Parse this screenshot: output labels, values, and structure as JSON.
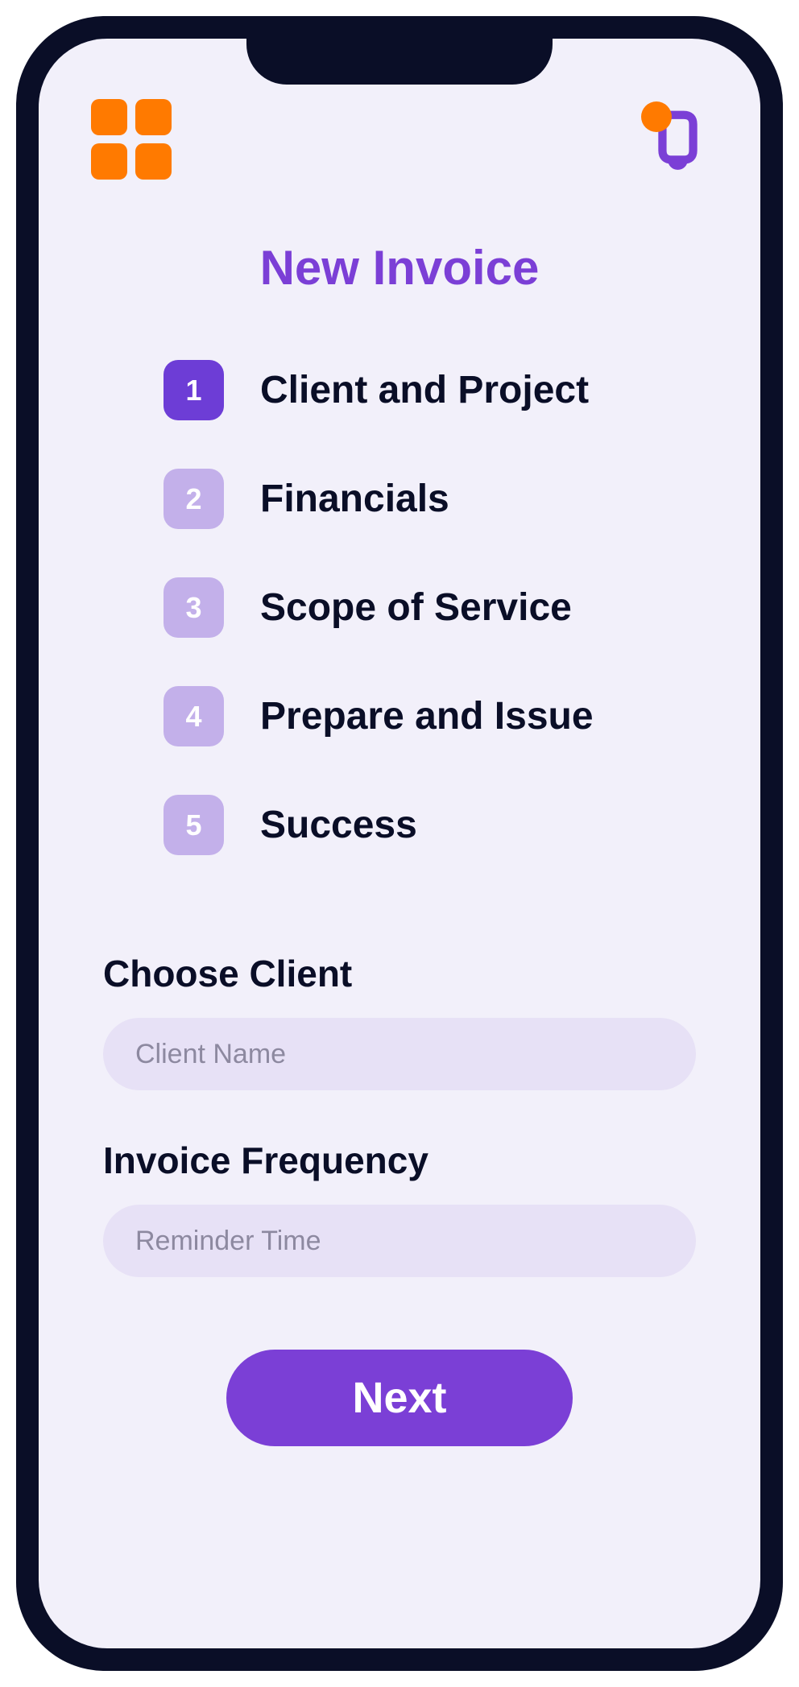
{
  "header": {
    "menu_icon": "apps-grid-icon",
    "notification_icon": "bell-icon"
  },
  "page_title": "New Invoice",
  "steps": [
    {
      "number": "1",
      "label": "Client and Project",
      "active": true
    },
    {
      "number": "2",
      "label": "Financials",
      "active": false
    },
    {
      "number": "3",
      "label": "Scope of Service",
      "active": false
    },
    {
      "number": "4",
      "label": "Prepare and Issue",
      "active": false
    },
    {
      "number": "5",
      "label": "Success",
      "active": false
    }
  ],
  "form": {
    "client": {
      "label": "Choose Client",
      "placeholder": "Client Name",
      "value": ""
    },
    "frequency": {
      "label": "Invoice Frequency",
      "placeholder": "Reminder Time",
      "value": ""
    }
  },
  "actions": {
    "next_label": "Next"
  },
  "colors": {
    "accent_purple": "#7b3fd6",
    "accent_orange": "#ff7a00",
    "step_inactive": "#c3b0ea",
    "input_bg": "#e7e1f6",
    "screen_bg": "#f2f0fa",
    "frame_bg": "#0a0e27"
  }
}
